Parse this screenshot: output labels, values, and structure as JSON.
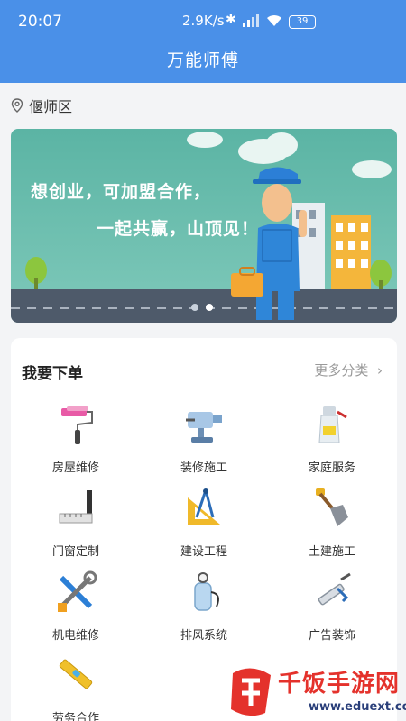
{
  "status_bar": {
    "time": "20:07",
    "net_speed": "2.9K/s",
    "battery": "39"
  },
  "header": {
    "title": "万能师傅"
  },
  "location": {
    "icon": "location-pin-icon",
    "name": "偃师区"
  },
  "banner": {
    "line1": "想创业，可加盟合作，",
    "line2": "一起共赢，山顶见！",
    "slide_count": 2,
    "active_slide": 2
  },
  "order": {
    "title": "我要下单",
    "more_label": "更多分类",
    "categories": [
      {
        "label": "房屋维修",
        "icon": "paint-roller-icon"
      },
      {
        "label": "装修施工",
        "icon": "vise-icon"
      },
      {
        "label": "家庭服务",
        "icon": "cleaning-spray-icon"
      },
      {
        "label": "门窗定制",
        "icon": "square-ruler-icon"
      },
      {
        "label": "建设工程",
        "icon": "compass-ruler-icon"
      },
      {
        "label": "土建施工",
        "icon": "shovel-icon"
      },
      {
        "label": "机电维修",
        "icon": "tools-cross-icon"
      },
      {
        "label": "排风系统",
        "icon": "pressure-tank-icon"
      },
      {
        "label": "广告装饰",
        "icon": "caulk-gun-icon"
      },
      {
        "label": "劳务合作",
        "icon": "level-tool-icon"
      }
    ]
  },
  "watermark": {
    "text": "千饭手游网",
    "url": "www.eduext.com"
  }
}
